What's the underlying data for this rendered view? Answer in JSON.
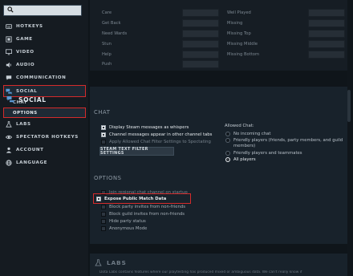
{
  "sidebar": {
    "search_placeholder": "",
    "items": [
      {
        "label": "HOTKEYS",
        "icon": "keyboard-icon"
      },
      {
        "label": "GAME",
        "icon": "game-icon"
      },
      {
        "label": "VIDEO",
        "icon": "monitor-icon"
      },
      {
        "label": "AUDIO",
        "icon": "speaker-icon"
      },
      {
        "label": "COMMUNICATION",
        "icon": "chat-bubble-icon"
      },
      {
        "label": "SOCIAL",
        "icon": "social-icon"
      },
      {
        "label": "LABS",
        "icon": "flask-icon"
      },
      {
        "label": "SPECTATOR HOTKEYS",
        "icon": "spectator-icon"
      },
      {
        "label": "ACCOUNT",
        "icon": "person-icon"
      },
      {
        "label": "LANGUAGE",
        "icon": "globe-icon"
      }
    ],
    "social_sub": [
      {
        "label": "CHAT"
      },
      {
        "label": "OPTIONS"
      }
    ]
  },
  "hotkeys_left": [
    "Care",
    "Get Back",
    "Need Wards",
    "Stun",
    "Help",
    "Push"
  ],
  "hotkeys_right": [
    "Well Played",
    "Missing",
    "Missing Top",
    "Missing Middle",
    "Missing Bottom"
  ],
  "social": {
    "title": "SOCIAL",
    "chat_title": "CHAT",
    "chat_checks": [
      {
        "label": "Display Steam messages as whispers",
        "checked": true
      },
      {
        "label": "Channel messages appear in other channel tabs",
        "checked": true
      },
      {
        "label": "Apply Allowed Chat Filter Settings to Spectating",
        "checked": false
      }
    ],
    "filter_button": "STEAM TEXT FILTER SETTINGS",
    "allowed_chat_title": "Allowed Chat:",
    "allowed_chat_options": [
      {
        "label": "No incoming chat",
        "selected": false
      },
      {
        "label": "Friendly players (friends, party members, and guild",
        "selected": false
      },
      {
        "label": "members)",
        "selected": false
      },
      {
        "label": "Friendly players and teammates",
        "selected": false
      },
      {
        "label": "All players",
        "selected": true
      }
    ],
    "options_title": "OPTIONS",
    "option_checks": [
      {
        "label": "Join regional chat channel on startup",
        "checked": false
      },
      {
        "label": "Expose Public Match Data",
        "checked": true
      },
      {
        "label": "Block party invites from non-friends",
        "checked": false
      },
      {
        "label": "Block guild invites from non-friends",
        "checked": false
      },
      {
        "label": "Hide party status",
        "checked": false
      },
      {
        "label": "Anonymous Mode",
        "checked": false
      }
    ]
  },
  "labs": {
    "title": "LABS",
    "description": "Dota Labs contains features where our playtesting has produced mixed or ambiguous data. We can't really know if"
  }
}
